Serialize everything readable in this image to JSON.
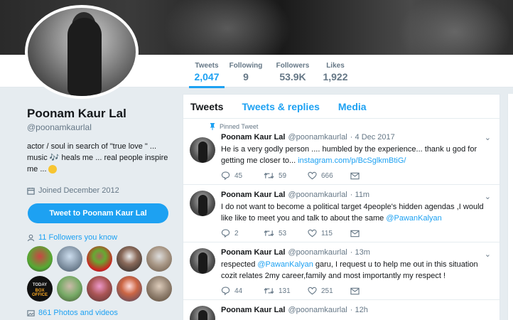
{
  "stats": [
    {
      "label": "Tweets",
      "value": "2,047"
    },
    {
      "label": "Following",
      "value": "9"
    },
    {
      "label": "Followers",
      "value": "53.9K"
    },
    {
      "label": "Likes",
      "value": "1,922"
    }
  ],
  "profile": {
    "name": "Poonam Kaur Lal",
    "handle": "@poonamkaurlal",
    "bio_1": "actor / soul in search of \"true love \" ... music ",
    "bio_2": " heals me ... real people inspire me ...",
    "joined": "Joined December 2012",
    "tweet_to_button": "Tweet to Poonam Kaur Lal",
    "followers_you_know": "11 Followers you know",
    "photos_videos": "861 Photos and videos"
  },
  "follower_thumb_texts": [
    "TODAY",
    "BOX OFFICE"
  ],
  "tabs": [
    "Tweets",
    "Tweets & replies",
    "Media"
  ],
  "tweets": [
    {
      "pinned": "Pinned Tweet",
      "name": "Poonam Kaur Lal",
      "handle": "@poonamkaurlal",
      "time": "· 4 Dec 2017",
      "text": "He is a very godly person .... humbled by the experience... thank u god for getting me closer to... ",
      "link": "instagram.com/p/BcSglkmBtiG/",
      "text_after": "",
      "replies": "45",
      "retweets": "59",
      "likes": "666"
    },
    {
      "pinned": "",
      "name": "Poonam Kaur Lal",
      "handle": "@poonamkaurlal",
      "time": "· 11m",
      "text": "I do not want to become a political target 4people's hidden agendas ,I would like like to meet you and talk to about the same ",
      "link": "@PawanKalyan",
      "text_after": "",
      "replies": "2",
      "retweets": "53",
      "likes": "115"
    },
    {
      "pinned": "",
      "name": "Poonam Kaur Lal",
      "handle": "@poonamkaurlal",
      "time": "· 13m",
      "text": "respected ",
      "link": "@PawanKalyan",
      "text_after": " garu, I request u to help me out in this situation cozit relates  2my career,family and most importantly my respect !",
      "replies": "44",
      "retweets": "131",
      "likes": "251"
    },
    {
      "pinned": "",
      "name": "Poonam Kaur Lal",
      "handle": "@poonamkaurlal",
      "time": "· 12h",
      "text": "",
      "link": "",
      "text_after": "",
      "replies": "",
      "retweets": "",
      "likes": ""
    }
  ],
  "colors": {
    "accent": "#1da1f2",
    "background": "#e6ecf0",
    "text": "#14171a",
    "muted": "#657786"
  }
}
